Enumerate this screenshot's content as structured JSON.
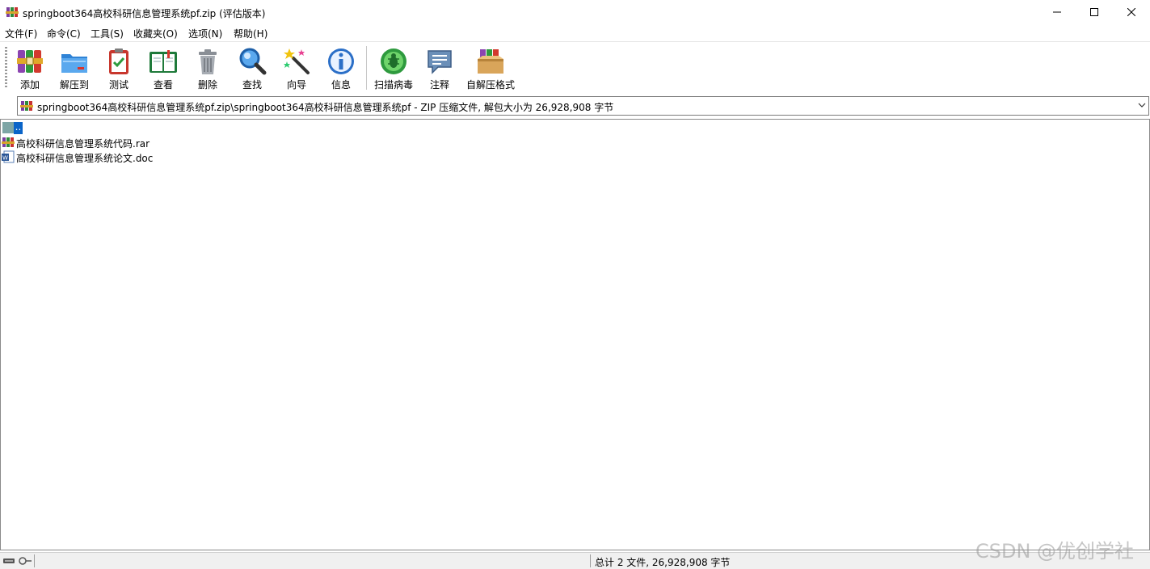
{
  "window": {
    "title": "springboot364高校科研信息管理系统pf.zip (评估版本)"
  },
  "menu": [
    "文件(F)",
    "命令(C)",
    "工具(S)",
    "收藏夹(O)",
    "选项(N)",
    "帮助(H)"
  ],
  "toolbar": [
    {
      "label": "添加",
      "icon": "add-archive-icon"
    },
    {
      "label": "解压到",
      "icon": "extract-folder-icon"
    },
    {
      "label": "测试",
      "icon": "test-clipboard-icon"
    },
    {
      "label": "查看",
      "icon": "view-book-icon"
    },
    {
      "label": "删除",
      "icon": "delete-trash-icon"
    },
    {
      "label": "查找",
      "icon": "find-magnifier-icon"
    },
    {
      "label": "向导",
      "icon": "wizard-wand-icon"
    },
    {
      "label": "信息",
      "icon": "info-icon"
    },
    {
      "label": "扫描病毒",
      "icon": "virus-scan-icon"
    },
    {
      "label": "注释",
      "icon": "comment-icon"
    },
    {
      "label": "自解压格式",
      "icon": "sfx-box-icon"
    }
  ],
  "address": {
    "path": "springboot364高校科研信息管理系统pf.zip\\springboot364高校科研信息管理系统pf - ZIP 压缩文件, 解包大小为 26,928,908 字节"
  },
  "files": [
    {
      "name": "..",
      "icon": "parent-folder-icon"
    },
    {
      "name": "高校科研信息管理系统代码.rar",
      "icon": "rar-file-icon"
    },
    {
      "name": "高校科研信息管理系统论文.doc",
      "icon": "word-doc-icon"
    }
  ],
  "status": {
    "summary": "总计 2 文件, 26,928,908 字节"
  },
  "watermark": "CSDN @优创学社"
}
